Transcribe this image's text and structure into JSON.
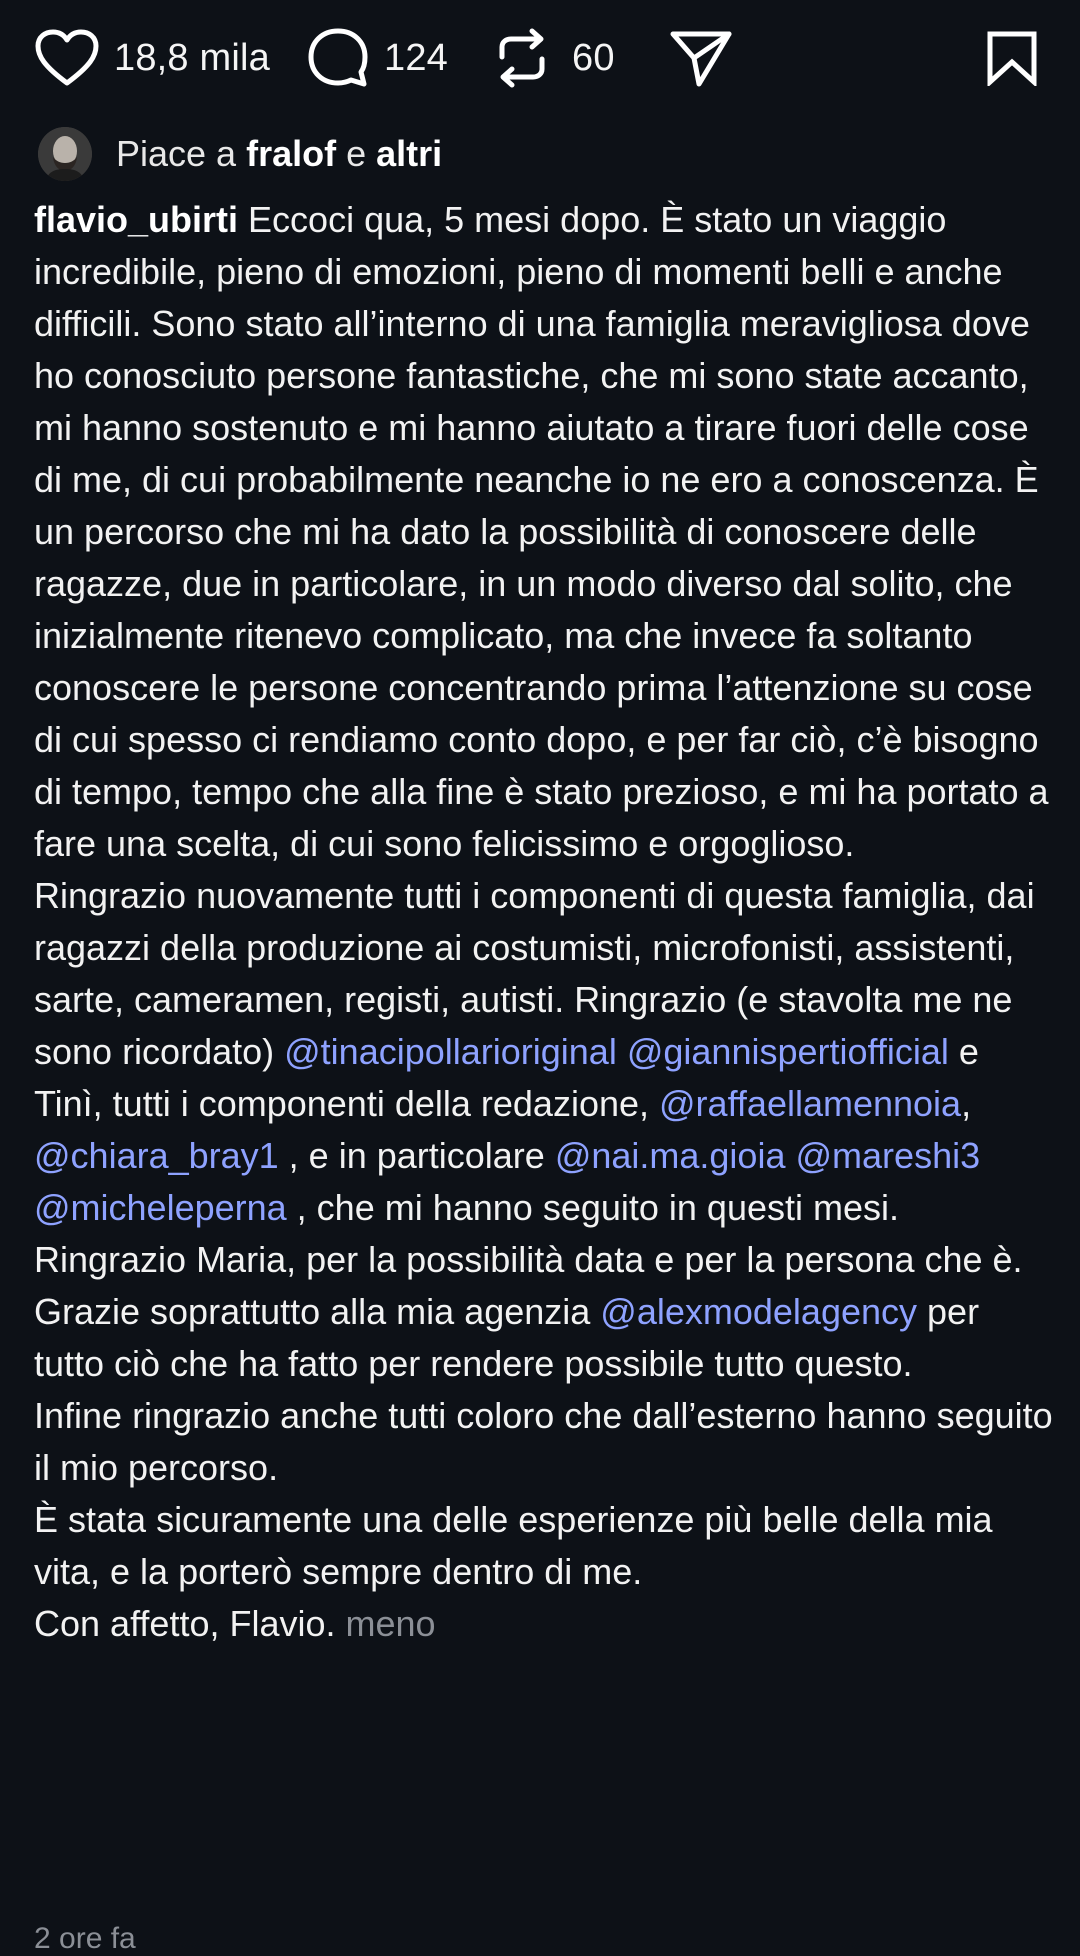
{
  "actions": {
    "likes": "18,8 mila",
    "comments": "124",
    "reposts": "60"
  },
  "liked_by": {
    "prefix": "Piace a",
    "user": "fralof",
    "joiner": "e",
    "others": "altri"
  },
  "caption": {
    "username": "flavio_ubirti",
    "p1": " Eccoci qua, 5 mesi dopo. È stato un viaggio incredibile, pieno di emozioni, pieno di momenti belli e anche difficili. Sono stato all’interno di una famiglia meravigliosa dove ho conosciuto persone fantastiche, che mi sono state accanto, mi hanno sostenuto e mi hanno aiutato a tirare fuori delle cose di me, di cui probabilmente neanche io ne ero a conoscenza. È un percorso che mi ha dato la possibilità di conoscere delle ragazze, due in particolare, in un modo diverso dal solito, che inizialmente ritenevo complicato, ma che invece fa soltanto conoscere le persone concentrando prima l’attenzione su cose di cui spesso ci rendiamo conto dopo, e per far ciò, c’è bisogno di tempo, tempo che alla fine è stato prezioso, e mi ha portato a fare una scelta, di cui sono felicissimo e orgoglioso.",
    "p2a": "Ringrazio nuovamente tutti i componenti di questa famiglia, dai ragazzi della produzione ai costumisti, microfonisti, assistenti, sarte, cameramen, registi, autisti. Ringrazio (e stavolta me ne sono ricordato) ",
    "m1": "@tinacipollarioriginal",
    "s1": " ",
    "m2": "@giannispertiofficial",
    "s2": " e Tinì, tutti i componenti della redazione, ",
    "m3": "@raffaellamennoia",
    "s3": ", ",
    "m4": "@chiara_bray1",
    "s4": " , e in particolare ",
    "m5": "@nai.ma.gioia",
    "s5": " ",
    "m6": "@mareshi3",
    "s6": " ",
    "m7": "@micheleperna",
    "s7": " , che mi hanno seguito in questi mesi. Ringrazio Maria, per la possibilità data e per la persona che è. Grazie soprattutto alla mia agenzia ",
    "m8": "@alexmodelagency",
    "s8": " per tutto ciò che ha fatto per rendere possibile tutto questo.",
    "p3": "Infine ringrazio anche tutti coloro che dall’esterno hanno seguito il mio percorso.",
    "p4": "È stata sicuramente una delle esperienze più belle della mia vita, e la porterò sempre dentro di me.",
    "p5": "Con affetto, Flavio. ",
    "less": "meno"
  },
  "timestamp": "2 ore fa",
  "colors": {
    "background": "#0d1117",
    "mention": "#8ea2ff",
    "muted": "#8b8f96"
  },
  "icons": [
    "heart-icon",
    "comment-icon",
    "repost-icon",
    "share-icon",
    "bookmark-icon"
  ]
}
